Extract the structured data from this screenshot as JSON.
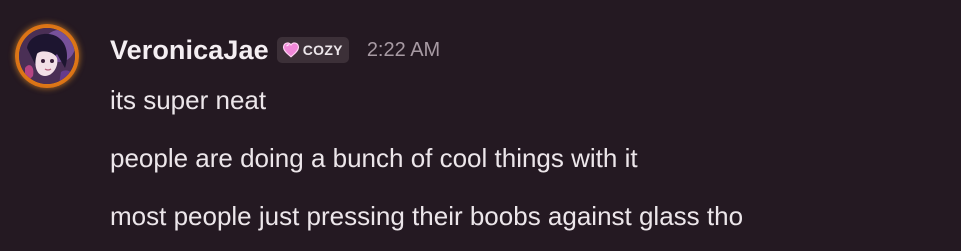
{
  "message": {
    "username": "VeronicaJae",
    "tag": {
      "icon": "heart-icon",
      "label": "COZY",
      "color": "#f088d8"
    },
    "timestamp": "2:22 AM",
    "avatar_ring_color": "#f5a623",
    "lines": [
      "its super neat",
      "people are doing a bunch of cool things with it",
      "most people just pressing their boobs against glass tho"
    ]
  }
}
